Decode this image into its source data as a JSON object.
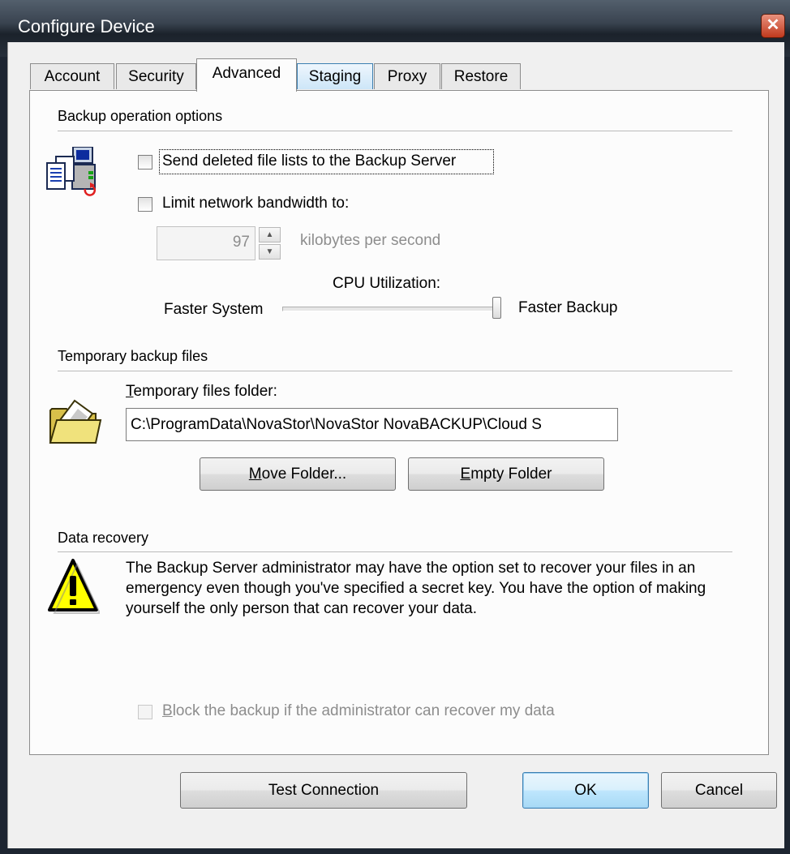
{
  "window": {
    "title": "Configure Device",
    "close_glyph": "✕"
  },
  "tabs": [
    {
      "label": "Account"
    },
    {
      "label": "Security"
    },
    {
      "label": "Advanced"
    },
    {
      "label": "Staging"
    },
    {
      "label": "Proxy"
    },
    {
      "label": "Restore"
    }
  ],
  "active_tab": "Advanced",
  "backup_options": {
    "group_label": "Backup operation options",
    "icon": "computer-documents-icon",
    "send_deleted": {
      "label": "Send deleted file lists to the Backup Server",
      "checked": false
    },
    "limit_bandwidth": {
      "label": "Limit network bandwidth to:",
      "checked": false
    },
    "bandwidth": {
      "value": "97",
      "unit": "kilobytes per second",
      "enabled": false
    },
    "cpu": {
      "caption": "CPU Utilization:",
      "left_label": "Faster System",
      "right_label": "Faster Backup",
      "level": 1.0
    }
  },
  "temp_files": {
    "group_label": "Temporary backup files",
    "icon": "open-folder-icon",
    "folder_label_key": "T",
    "folder_label_rest": "emporary files folder:",
    "folder_path": "C:\\ProgramData\\NovaStor\\NovaStor NovaBACKUP\\Cloud S",
    "move_key": "M",
    "move_rest": "ove Folder...",
    "empty_key": "E",
    "empty_rest": "mpty Folder"
  },
  "data_recovery": {
    "group_label": "Data recovery",
    "icon": "warning-icon",
    "text": "The Backup Server administrator may have the option set to recover your files in an emergency even though you've specified a secret key.  You have the option of making yourself the only person that can recover your data.",
    "block_key": "B",
    "block_rest": "lock the backup if the administrator can recover my data",
    "block_checked": false,
    "block_enabled": false
  },
  "buttons": {
    "test_connection": "Test Connection",
    "ok": "OK",
    "cancel": "Cancel"
  }
}
